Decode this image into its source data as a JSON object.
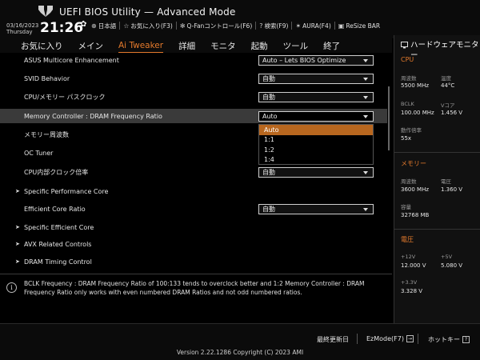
{
  "header": {
    "title": "UEFI BIOS Utility — Advanced Mode",
    "date": "03/16/2023",
    "day": "Thursday",
    "time": "21:26",
    "tools": [
      {
        "icon": "globe-icon",
        "glyph": "⊕",
        "label": "日本語"
      },
      {
        "icon": "star-icon",
        "glyph": "☆",
        "label": "お気に入り(F3)"
      },
      {
        "icon": "fan-icon",
        "glyph": "✻",
        "label": "Q-Fanコントロール(F6)"
      },
      {
        "icon": "search-icon",
        "glyph": "?",
        "label": "検索(F9)"
      },
      {
        "icon": "aura-icon",
        "glyph": "✶",
        "label": "AURA(F4)"
      },
      {
        "icon": "resize-bar-icon",
        "glyph": "▣",
        "label": "ReSize BAR"
      }
    ]
  },
  "menu": [
    {
      "label": "お気に入り",
      "active": false
    },
    {
      "label": "メイン",
      "active": false
    },
    {
      "label": "Ai Tweaker",
      "active": true
    },
    {
      "label": "詳細",
      "active": false
    },
    {
      "label": "モニタ",
      "active": false
    },
    {
      "label": "起動",
      "active": false
    },
    {
      "label": "ツール",
      "active": false
    },
    {
      "label": "終了",
      "active": false
    }
  ],
  "settings": [
    {
      "label": "ASUS Multicore Enhancement",
      "value": "Auto – Lets BIOS Optimize"
    },
    {
      "label": "SVID Behavior",
      "value": "自動"
    },
    {
      "label": "CPU/メモリー パスクロック",
      "value": "自動"
    },
    {
      "label": "Memory Controller : DRAM Frequency Ratio",
      "value": "Auto"
    },
    {
      "label": "メモリー周波数",
      "value": ""
    },
    {
      "label": "OC Tuner",
      "value": ""
    },
    {
      "label": "CPU内部クロック倍率",
      "value": "自動"
    },
    {
      "label": "Specific Performance Core",
      "value": ""
    },
    {
      "label": "Efficient Core Ratio",
      "value": "自動"
    },
    {
      "label": "Specific Efficient Core",
      "value": ""
    },
    {
      "label": "AVX Related Controls",
      "value": ""
    },
    {
      "label": "DRAM Timing Control",
      "value": ""
    }
  ],
  "dropdown": {
    "options": [
      "Auto",
      "1:1",
      "1:2",
      "1:4"
    ],
    "selected": "Auto"
  },
  "help": {
    "text": "BCLK Frequency : DRAM Frequency Ratio of 100:133 tends to overclock better and 1:2 Memory Controller : DRAM Frequency Ratio only works with even numbered DRAM Ratios and not odd numbered ratios."
  },
  "hardware_monitor": {
    "title": "ハードウェアモニター",
    "cpu": {
      "section": "CPU",
      "freq_label": "周波数",
      "freq": "5500 MHz",
      "temp_label": "温度",
      "temp": "44°C",
      "bclk_label": "BCLK",
      "bclk": "100.00 MHz",
      "vcore_label": "Vコア",
      "vcore": "1.456 V",
      "ratio_label": "動作倍率",
      "ratio": "55x"
    },
    "memory": {
      "section": "メモリー",
      "freq_label": "周波数",
      "freq": "3600 MHz",
      "volt_label": "電圧",
      "volt": "1.360 V",
      "cap_label": "容量",
      "cap": "32768 MB"
    },
    "voltage": {
      "section": "電圧",
      "v12_label": "+12V",
      "v12": "12.000 V",
      "v5_label": "+5V",
      "v5": "5.080 V",
      "v33_label": "+3.3V",
      "v33": "3.328 V"
    }
  },
  "footer": {
    "last_modified": "最終更新日",
    "ezmode": "EzMode(F7)",
    "hotkeys": "ホットキー",
    "hotkeys_icon": "?",
    "copyright": "Version 2.22.1286 Copyright (C) 2023 AMI"
  }
}
